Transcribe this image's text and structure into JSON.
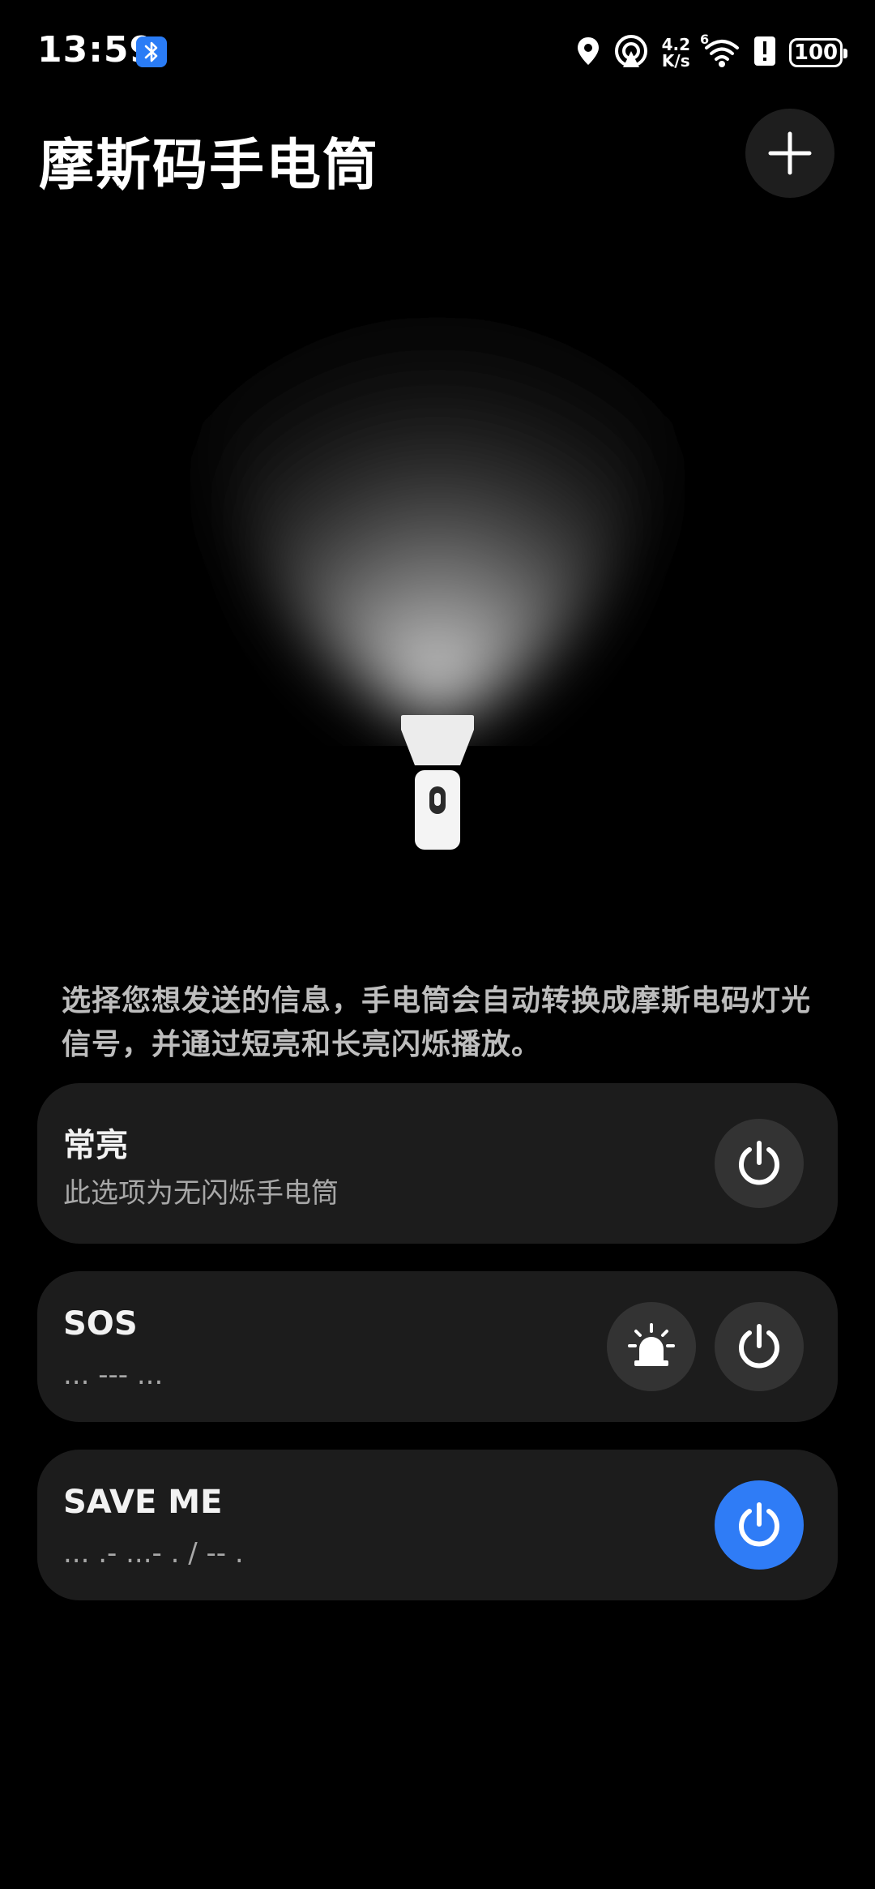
{
  "status_bar": {
    "time": "13:59",
    "network_speed_value": "4.2",
    "network_speed_unit": "K/s",
    "wifi_label": "6",
    "battery": "100",
    "icons": [
      "bluetooth-icon",
      "location-icon",
      "hotspot-icon",
      "wifi-icon",
      "alert-icon",
      "battery-icon"
    ]
  },
  "header": {
    "title": "摩斯码手电筒",
    "add_icon": "plus-icon"
  },
  "description": "选择您想发送的信息，手电筒会自动转换成摩斯电码灯光信号，并通过短亮和长亮闪烁播放。",
  "cards": [
    {
      "title": "常亮",
      "subtitle": "此选项为无闪烁手电筒",
      "power_active": false
    },
    {
      "title": "SOS",
      "subtitle": "... --- ...",
      "power_active": false,
      "extra_icon": "siren-icon"
    },
    {
      "title": "SAVE ME",
      "subtitle": "... .- ...- . / -- .",
      "power_active": true
    }
  ],
  "colors": {
    "background": "#000000",
    "card": "#1c1c1c",
    "button": "#333333",
    "accent": "#2f7cf6"
  }
}
